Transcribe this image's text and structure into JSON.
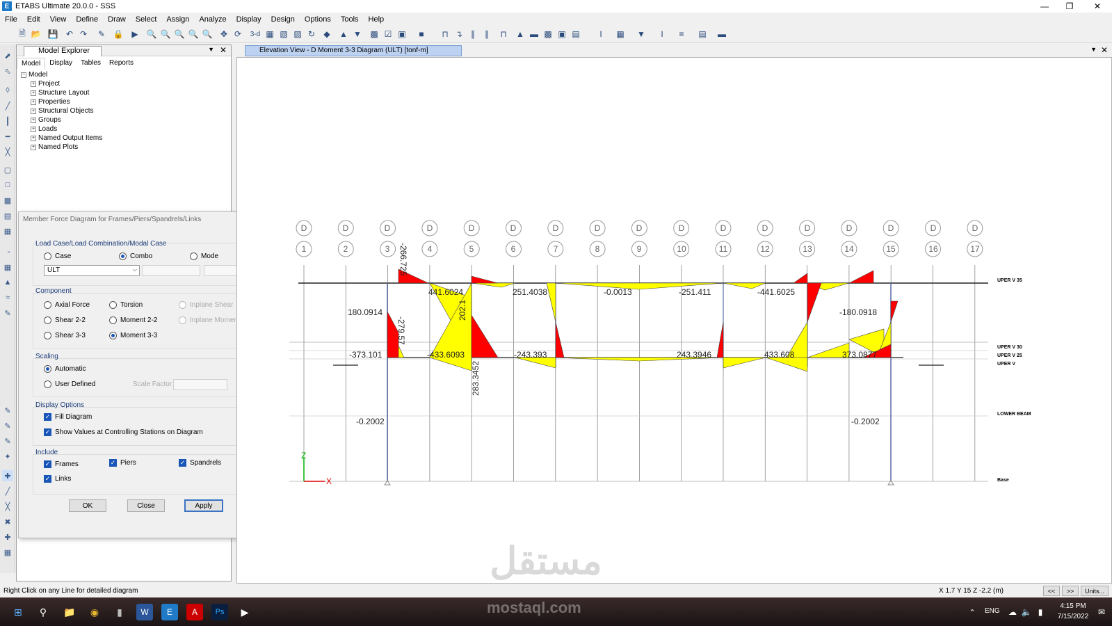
{
  "window": {
    "title": "ETABS Ultimate 20.0.0 - SSS",
    "app_icon": "E"
  },
  "menu": [
    "File",
    "Edit",
    "View",
    "Define",
    "Draw",
    "Select",
    "Assign",
    "Analyze",
    "Display",
    "Design",
    "Options",
    "Tools",
    "Help"
  ],
  "toolbar": {
    "threed_label": "3-d"
  },
  "explorer": {
    "title": "Model Explorer",
    "tabs": [
      "Model",
      "Display",
      "Tables",
      "Reports"
    ],
    "root": "Model",
    "items": [
      "Project",
      "Structure Layout",
      "Properties",
      "Structural Objects",
      "Groups",
      "Loads",
      "Named Output Items",
      "Named Plots"
    ]
  },
  "dialog": {
    "title": "Member Force Diagram for Frames/Piers/Spandrels/Links",
    "load_group": "Load Case/Load Combination/Modal Case",
    "case_label": "Case",
    "combo_label": "Combo",
    "mode_label": "Mode",
    "combo_value": "ULT",
    "component_group": "Component",
    "axial": "Axial Force",
    "torsion": "Torsion",
    "inplane_shear": "Inplane Shear",
    "shear22": "Shear 2-2",
    "moment22": "Moment 2-2",
    "inplane_moment": "Inplane Moment",
    "shear33": "Shear 3-3",
    "moment33": "Moment 3-3",
    "scaling_group": "Scaling",
    "automatic": "Automatic",
    "user_defined": "User Defined",
    "scale_factor": "Scale Factor",
    "display_group": "Display Options",
    "fill": "Fill Diagram",
    "show_values": "Show Values at Controlling Stations on Diagram",
    "include_group": "Include",
    "frames": "Frames",
    "piers": "Piers",
    "spandrels": "Spandrels",
    "links": "Links",
    "ok": "OK",
    "close": "Close",
    "apply": "Apply"
  },
  "view": {
    "tab_title": "Elevation View - D   Moment 3-3 Diagram   (ULT)  [tonf-m]",
    "grid_top": "D",
    "grid_numbers": [
      "1",
      "2",
      "3",
      "4",
      "5",
      "6",
      "7",
      "8",
      "9",
      "10",
      "11",
      "12",
      "13",
      "14",
      "15",
      "16",
      "17"
    ],
    "stories": [
      "UPER V 35",
      "UPER V 30",
      "UPER V 25",
      "UPER V",
      "LOWER BEAM",
      "Base"
    ],
    "values": {
      "v1": "-266.725",
      "v2": "441.6024",
      "v3": "202.1",
      "v4": "251.4038",
      "v5": "-0.0013",
      "v6": "-251.411",
      "v7": "-441.6025",
      "v8": "180.0914",
      "v9": "-180.0918",
      "v10": "-279.57",
      "v11": "-373.101",
      "v12": "-433.6093",
      "v13": "-243.393",
      "v14": "243.3946",
      "v15": "433.608",
      "v16": "373.0877",
      "v17": "283.3452",
      "v18": "-0.2002",
      "v19": "-0.2002"
    },
    "axis_x": "X",
    "axis_z": "Z"
  },
  "status": {
    "left": "Right Click on any Line for detailed diagram",
    "coords": "X 1.7  Y 15  Z -2.2 (m)",
    "prev": "<<",
    "next": ">>",
    "units": "Units..."
  },
  "taskbar": {
    "lang": "ENG",
    "time": "4:15 PM",
    "date": "7/15/2022"
  },
  "watermark": {
    "arabic": "مستقل",
    "latin": "mostaql.com"
  },
  "colors": {
    "moment_pos": "#ffff00",
    "moment_neg": "#ff0000",
    "accent": "#1a56b8"
  }
}
